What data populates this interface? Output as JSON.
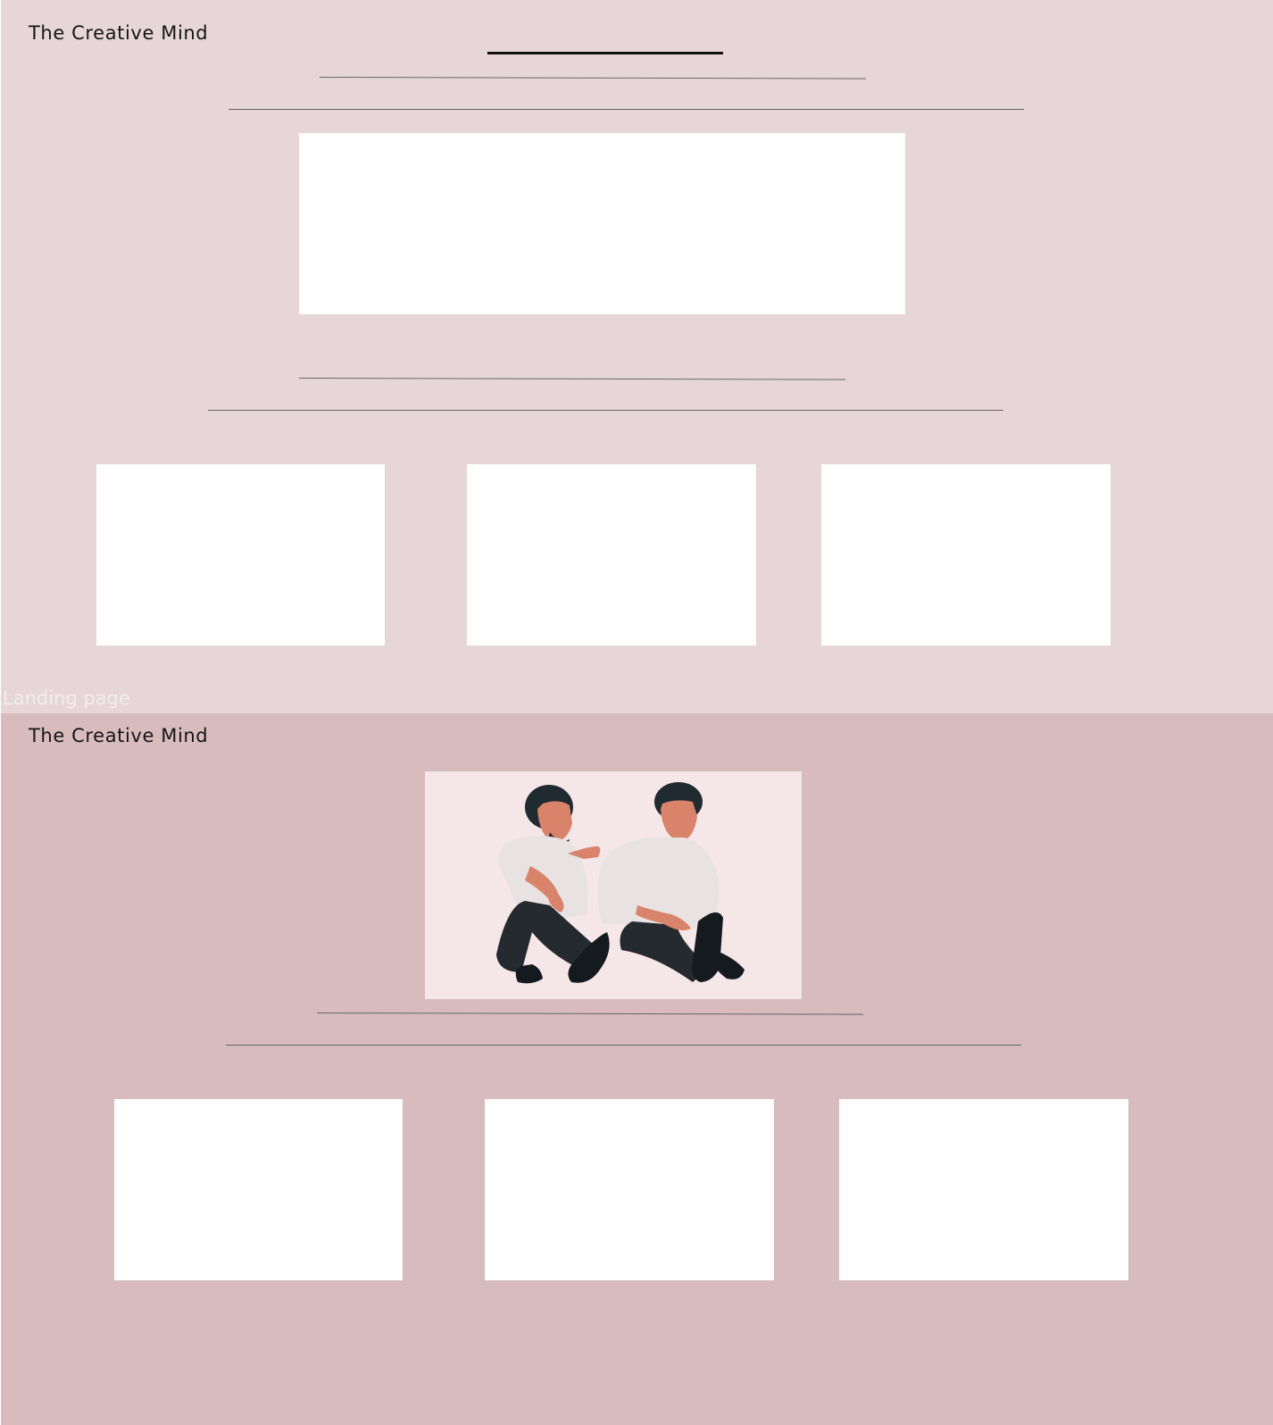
{
  "frames": [
    {
      "brand": "The Creative Mind",
      "label": "Landing page"
    },
    {
      "brand": "The Creative Mind",
      "illustration": "two-men-sitting-comforting-illustration"
    }
  ],
  "colors": {
    "frame_1_background": "#e6d6d7",
    "frame_2_background": "#d8bbbd",
    "placeholder": "#ffffff",
    "illustration_background": "#f5e6e7",
    "shirt": "#e8e2e2",
    "pants": "#252a2e",
    "skin": "#d9836a",
    "hair": "#202a31"
  }
}
